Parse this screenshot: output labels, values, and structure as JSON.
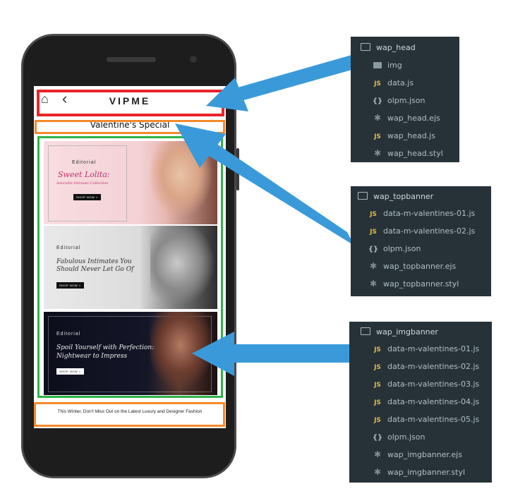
{
  "phone": {
    "brand": "VIPME",
    "head_icons": [
      "home-icon",
      "back-icon"
    ],
    "topbanner_title": "Valentine's Special",
    "banners": [
      {
        "label": "Editorial",
        "title_lines": [
          "Sweet Lolita:"
        ],
        "subtitle": "Adorable Intimate Collection",
        "button": "SHOP NOW >"
      },
      {
        "label": "Editorial",
        "title_lines": [
          "Fabulous Intimates You",
          "Should Never Let Go Of"
        ],
        "subtitle": "",
        "button": "SHOP NOW >"
      },
      {
        "label": "Editorial",
        "title_lines": [
          "Spoil Yourself with Perfection:",
          "Nightwear to Impress"
        ],
        "subtitle": "",
        "button": "SHOP NOW >"
      }
    ],
    "footer_text": "This Winter, Don't Miss Out on the Latest Luxury and Designer Fashion"
  },
  "highlight_colors": {
    "head": "#e8242a",
    "topbanner": "#f58a2c",
    "imgbanner": "#2db446",
    "footer": "#f58a2c",
    "arrow": "#3a9ad9"
  },
  "panels": [
    {
      "root": "wap_head",
      "items": [
        {
          "icon": "folder-icon",
          "name": "img"
        },
        {
          "icon": "js-icon",
          "name": "data.js"
        },
        {
          "icon": "json-icon",
          "name": "olpm.json"
        },
        {
          "icon": "asterisk-icon",
          "name": "wap_head.ejs"
        },
        {
          "icon": "js-icon",
          "name": "wap_head.js"
        },
        {
          "icon": "asterisk-icon",
          "name": "wap_head.styl"
        }
      ]
    },
    {
      "root": "wap_topbanner",
      "items": [
        {
          "icon": "js-icon",
          "name": "data-m-valentines-01.js"
        },
        {
          "icon": "js-icon",
          "name": "data-m-valentines-02.js"
        },
        {
          "icon": "json-icon",
          "name": "olpm.json"
        },
        {
          "icon": "asterisk-icon",
          "name": "wap_topbanner.ejs"
        },
        {
          "icon": "asterisk-icon",
          "name": "wap_topbanner.styl"
        }
      ]
    },
    {
      "root": "wap_imgbanner",
      "items": [
        {
          "icon": "js-icon",
          "name": "data-m-valentines-01.js"
        },
        {
          "icon": "js-icon",
          "name": "data-m-valentines-02.js"
        },
        {
          "icon": "js-icon",
          "name": "data-m-valentines-03.js"
        },
        {
          "icon": "js-icon",
          "name": "data-m-valentines-04.js"
        },
        {
          "icon": "js-icon",
          "name": "data-m-valentines-05.js"
        },
        {
          "icon": "json-icon",
          "name": "olpm.json"
        },
        {
          "icon": "asterisk-icon",
          "name": "wap_imgbanner.ejs"
        },
        {
          "icon": "asterisk-icon",
          "name": "wap_imgbanner.styl"
        }
      ]
    }
  ]
}
